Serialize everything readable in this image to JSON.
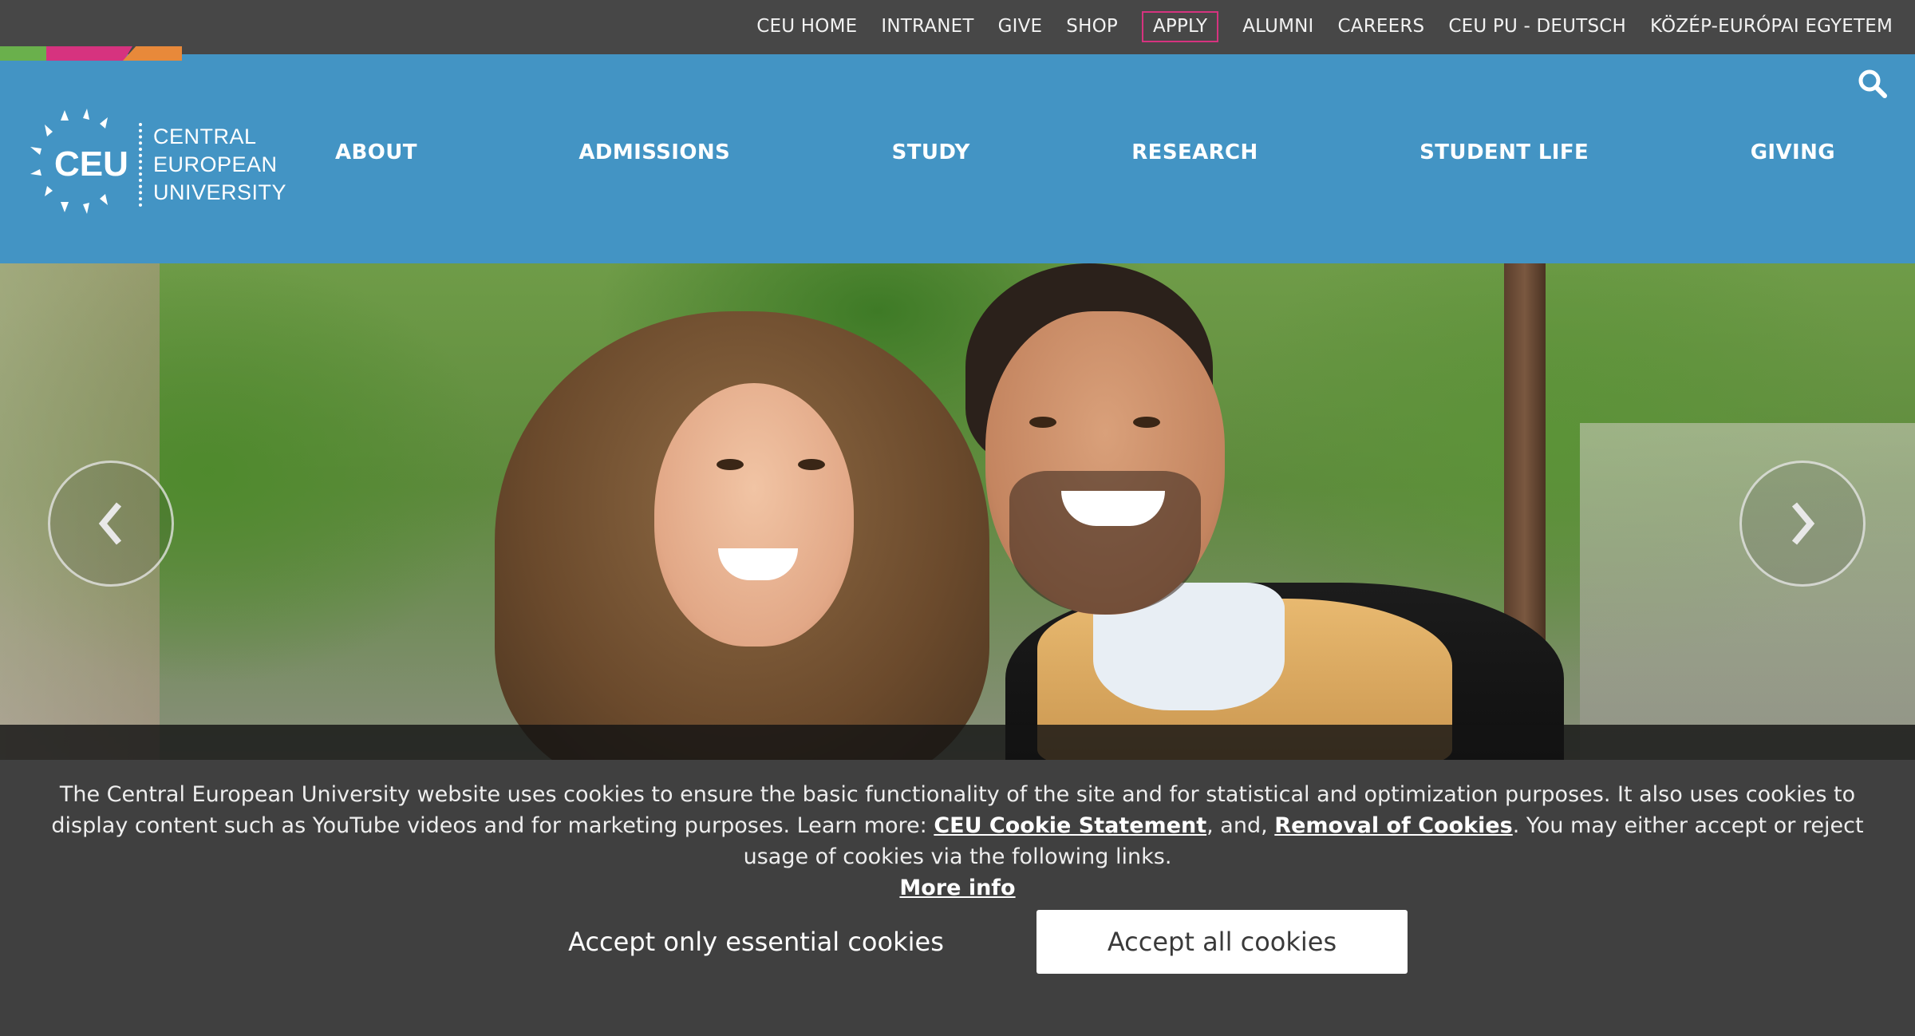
{
  "utility_nav": [
    {
      "label": "CEU HOME"
    },
    {
      "label": "INTRANET"
    },
    {
      "label": "GIVE"
    },
    {
      "label": "SHOP"
    },
    {
      "label": "APPLY"
    },
    {
      "label": "ALUMNI"
    },
    {
      "label": "CAREERS"
    },
    {
      "label": "CEU PU - DEUTSCH"
    },
    {
      "label": "KÖZÉP-EURÓPAI EGYETEM"
    }
  ],
  "logo": {
    "abbr": "CEU",
    "line1": "CENTRAL",
    "line2": "EUROPEAN",
    "line3": "UNIVERSITY"
  },
  "main_nav": [
    {
      "label": "ABOUT"
    },
    {
      "label": "ADMISSIONS"
    },
    {
      "label": "STUDY"
    },
    {
      "label": "RESEARCH"
    },
    {
      "label": "STUDENT LIFE"
    },
    {
      "label": "GIVING"
    }
  ],
  "cookie_banner": {
    "text_part1": "The Central European University website uses cookies to ensure the basic functionality of the site and for statistical and optimization purposes. It also uses cookies to display content such as YouTube videos and for marketing purposes. Learn more: ",
    "link_statement": "CEU Cookie Statement",
    "text_part2": ", and, ",
    "link_removal": "Removal of Cookies",
    "text_part3": ". You may either accept or reject usage of cookies via the following links.",
    "link_more": "More info",
    "btn_essential": "Accept only essential cookies",
    "btn_all": "Accept all cookies"
  },
  "colors": {
    "header_blue": "#4394c4",
    "topbar": "#474747",
    "apply_border": "#d6337f",
    "accent_green": "#6ab04c",
    "accent_pink": "#d6337f",
    "accent_orange": "#e8893a",
    "cookie_bg": "#404040"
  },
  "icons": {
    "search": "search-icon",
    "prev": "chevron-left-icon",
    "next": "chevron-right-icon",
    "logo_mark": "ceu-sunburst-logo-icon"
  }
}
